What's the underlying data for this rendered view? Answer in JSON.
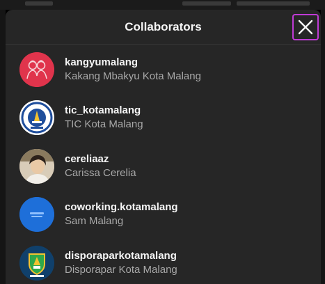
{
  "dialog": {
    "title": "Collaborators",
    "close_icon": "close-icon"
  },
  "collaborators": [
    {
      "username": "kangyumalang",
      "full_name": "Kakang Mbakyu Kota Malang",
      "avatar_icon": "couple-illustration-avatar",
      "avatar_color": "#e0344c"
    },
    {
      "username": "tic_kotamalang",
      "full_name": "TIC Kota Malang",
      "avatar_icon": "tic-emblem-avatar",
      "avatar_color": "#1f4e9c"
    },
    {
      "username": "cereliaaz",
      "full_name": "Carissa Cerelia",
      "avatar_icon": "person-photo-avatar",
      "avatar_color": "#c9b9a3"
    },
    {
      "username": "coworking.kotamalang",
      "full_name": "Sam Malang",
      "avatar_icon": "sam-logo-avatar",
      "avatar_color": "#1e6fd9"
    },
    {
      "username": "disporaparkotamalang",
      "full_name": "Disporapar Kota Malang",
      "avatar_icon": "disporapar-crest-avatar",
      "avatar_color": "#10406b"
    }
  ]
}
